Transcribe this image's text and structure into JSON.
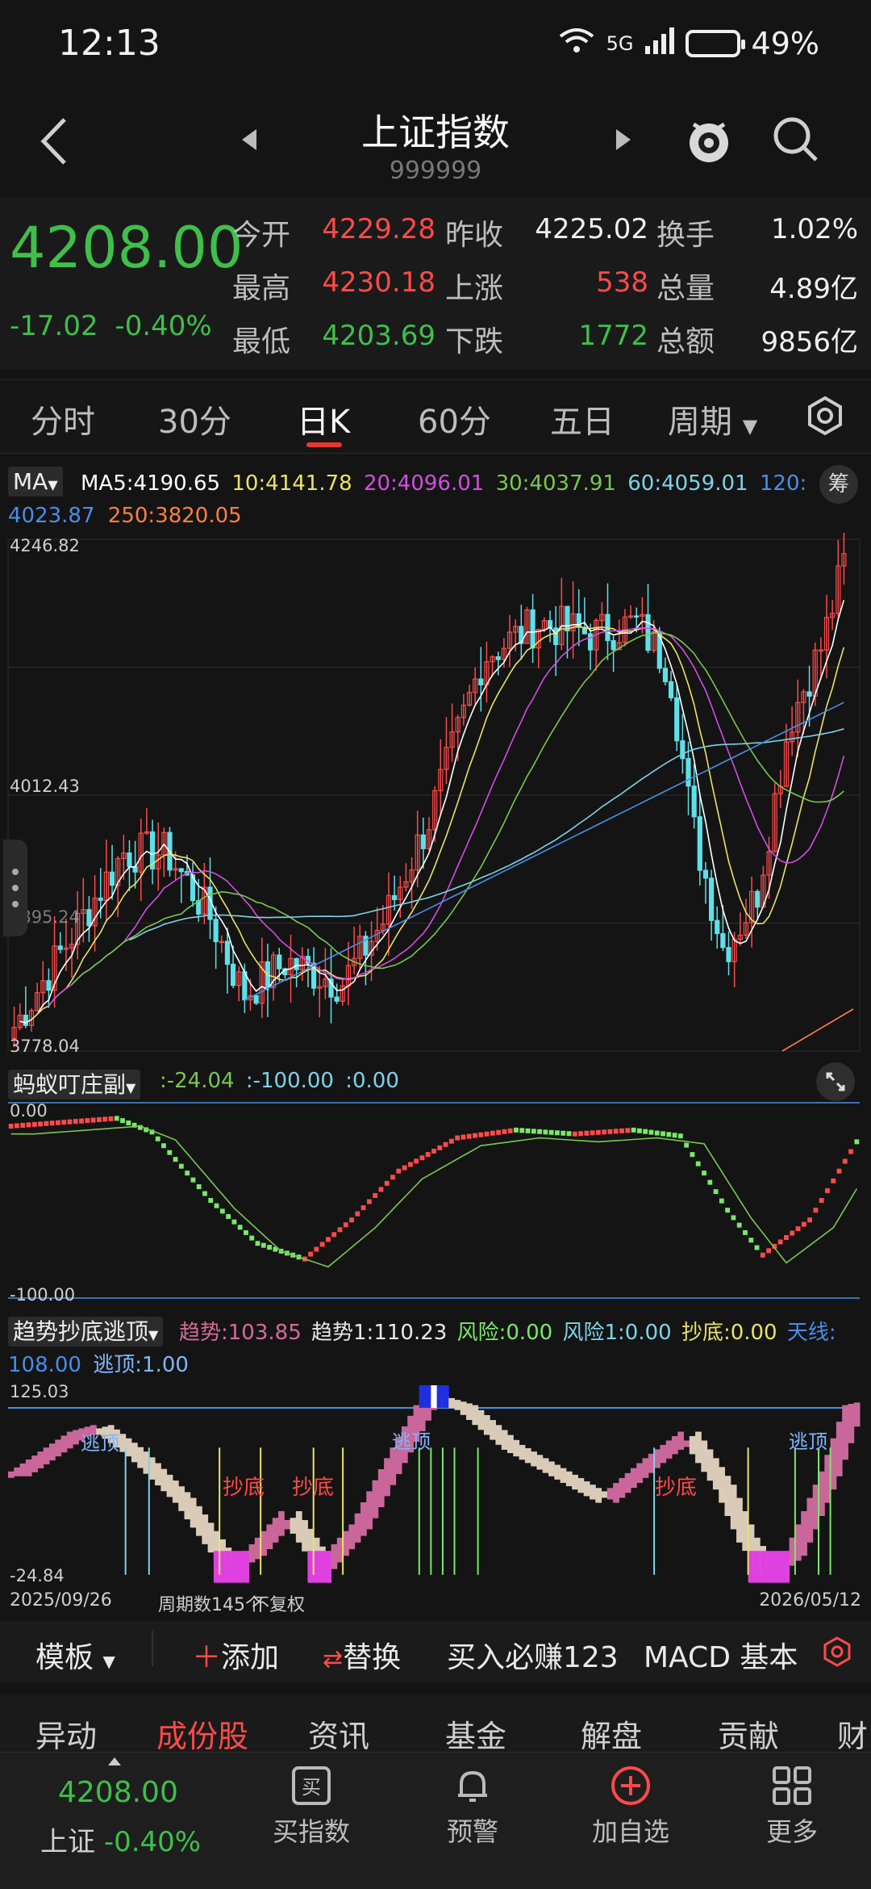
{
  "status": {
    "time": "12:13",
    "network": "5G",
    "battery": "49%"
  },
  "header": {
    "title": "上证指数",
    "code": "999999"
  },
  "quote": {
    "price": "4208.00",
    "change": "-17.02",
    "change_pct": "-0.40%",
    "rows": [
      {
        "l1": "今开",
        "v1": "4229.28",
        "l2": "昨收",
        "v2": "4225.02",
        "l3": "换手",
        "v3": "1.02%"
      },
      {
        "l1": "最高",
        "v1": "4230.18",
        "l2": "上涨",
        "v2": "538",
        "l3": "总量",
        "v3": "4.89亿"
      },
      {
        "l1": "最低",
        "v1": "4203.69",
        "l2": "下跌",
        "v2": "1772",
        "l3": "总额",
        "v3": "9856亿"
      }
    ]
  },
  "tabs": [
    "分时",
    "30分",
    "日K",
    "60分",
    "五日",
    "周期"
  ],
  "active_tab": "日K",
  "ma_bar": {
    "dropdown": "MA",
    "ma5": "MA5:4190.65",
    "ma10": "10:4141.78",
    "ma20": "20:4096.01",
    "ma30": "30:4037.91",
    "ma60": "60:4059.01",
    "ma120_label": "120:",
    "ma120": "4023.87",
    "ma250": "250:3820.05",
    "chou": "筹"
  },
  "colors": {
    "up": "#ff4a4a",
    "down": "#3fbf4a",
    "ma5": "#ffffff",
    "ma10": "#e8e36a",
    "ma20": "#d24ee0",
    "ma30": "#7ac74f",
    "ma60": "#7fd3e8",
    "ma120": "#4a8de8",
    "ma250": "#ff7f3f"
  },
  "kline_axis": {
    "top": "4246.82",
    "mid": "4012.43",
    "mid2": "3895.24",
    "bottom": "3778.04"
  },
  "ind1": {
    "name": "蚂蚁叮庄副",
    "v1": ":-24.04",
    "v2": ":-100.00",
    "v3": ":0.00",
    "axis_top": "0.00",
    "axis_bottom": "-100.00"
  },
  "ind2": {
    "name": "趋势抄底逃顶",
    "trend": "趋势:103.85",
    "trend1": "趋势1:110.23",
    "risk": "风险:0.00",
    "risk1": "风险1:0.00",
    "chaodi": "抄底:0.00",
    "tianxian": "天线:",
    "tianxian_val": "108.00",
    "taoding": "逃顶:1.00",
    "axis_top": "125.03",
    "axis_bottom": "-24.84",
    "labels": {
      "taoding": "逃顶",
      "chaodi": "抄底"
    }
  },
  "date_bar": {
    "start": "2025/09/26",
    "period": "周期数145个",
    "adj": "不复权",
    "end": "2026/05/12"
  },
  "toolbar": {
    "template": "模板",
    "add": "添加",
    "replace": "替换",
    "buy": "买入必赚123",
    "macd": "MACD 基本"
  },
  "bottom_tabs": [
    "异动",
    "成份股",
    "资讯",
    "基金",
    "解盘",
    "贡献",
    "财"
  ],
  "bottom_nav": {
    "index_price": "4208.00",
    "index_name": "上证",
    "index_pct": "-0.40%",
    "items": [
      "买指数",
      "预警",
      "加自选",
      "更多"
    ]
  }
}
